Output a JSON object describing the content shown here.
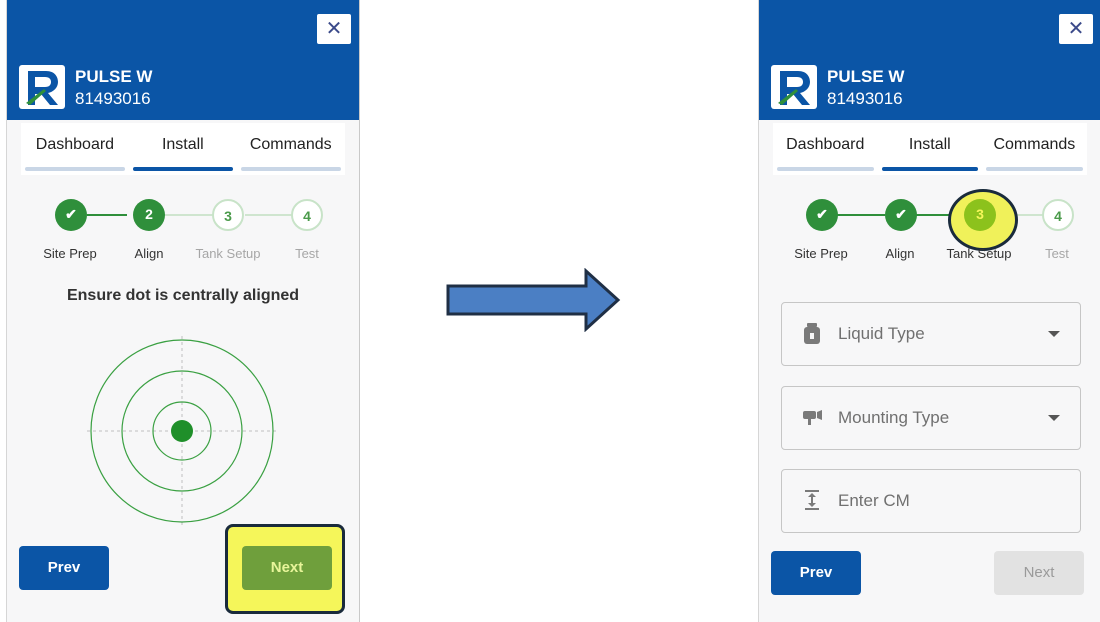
{
  "colors": {
    "header_blue": "#0b55a6",
    "step_done_green": "#2f8f3b",
    "highlight_yellow": "#f5f65a",
    "target_green": "#1f8f2a",
    "arrow_blue": "#4b7fc4"
  },
  "left_panel": {
    "close_icon": "close-icon",
    "device_name": "PULSE W",
    "device_id": "81493016",
    "tabs": [
      {
        "label": "Dashboard",
        "active": false
      },
      {
        "label": "Install",
        "active": true
      },
      {
        "label": "Commands",
        "active": false
      }
    ],
    "steps": [
      {
        "number": "",
        "label": "Site Prep",
        "state": "done",
        "icon": "check-icon"
      },
      {
        "number": "2",
        "label": "Align",
        "state": "current"
      },
      {
        "number": "3",
        "label": "Tank Setup",
        "state": "pending"
      },
      {
        "number": "4",
        "label": "Test",
        "state": "pending"
      }
    ],
    "instruction": "Ensure dot is centrally aligned",
    "prev_label": "Prev",
    "next_label": "Next"
  },
  "transition_arrow": "right-arrow-icon",
  "right_panel": {
    "close_icon": "close-icon",
    "device_name": "PULSE W",
    "device_id": "81493016",
    "tabs": [
      {
        "label": "Dashboard",
        "active": false
      },
      {
        "label": "Install",
        "active": true
      },
      {
        "label": "Commands",
        "active": false
      }
    ],
    "steps": [
      {
        "number": "",
        "label": "Site Prep",
        "state": "done",
        "icon": "check-icon"
      },
      {
        "number": "",
        "label": "Align",
        "state": "done",
        "icon": "check-icon"
      },
      {
        "number": "3",
        "label": "Tank Setup",
        "state": "current"
      },
      {
        "number": "4",
        "label": "Test",
        "state": "pending"
      }
    ],
    "fields": {
      "liquid_type": {
        "placeholder": "Liquid Type",
        "icon": "liquid-bottle-icon",
        "dropdown": true
      },
      "mounting_type": {
        "placeholder": "Mounting Type",
        "icon": "sensor-mount-icon",
        "dropdown": true
      },
      "enter_cm": {
        "placeholder": "Enter CM",
        "icon": "vertical-resize-icon",
        "dropdown": false
      }
    },
    "prev_label": "Prev",
    "next_label": "Next"
  }
}
